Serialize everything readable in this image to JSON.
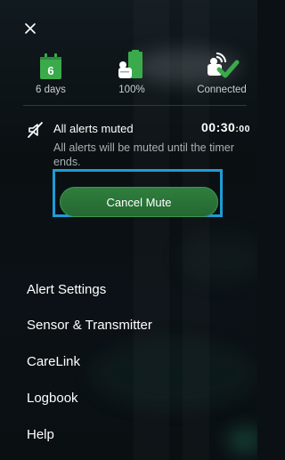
{
  "status": {
    "sensor": {
      "days_value": "6",
      "label": "6 days",
      "icon": "sensor-calendar-icon"
    },
    "battery": {
      "label": "100%",
      "icon": "pump-battery-icon"
    },
    "connection": {
      "label": "Connected",
      "icon": "connected-check-icon"
    }
  },
  "close": {
    "icon": "close-icon"
  },
  "mute": {
    "icon": "muted-speaker-icon",
    "title": "All alerts muted",
    "timer_main": "00:30",
    "timer_secs": ":00",
    "description": "All alerts will be muted until the timer ends.",
    "cancel_label": "Cancel Mute"
  },
  "menu": {
    "items": [
      {
        "label": "Alert Settings"
      },
      {
        "label": "Sensor & Transmitter"
      },
      {
        "label": "CareLink"
      },
      {
        "label": "Logbook"
      },
      {
        "label": "Help"
      }
    ]
  },
  "colors": {
    "background": "#0b1014",
    "accent_green": "#2f7e3d",
    "status_green": "#3aaa4a",
    "focus_blue": "#1e9cd6",
    "text_secondary": "#a7b0b5"
  }
}
